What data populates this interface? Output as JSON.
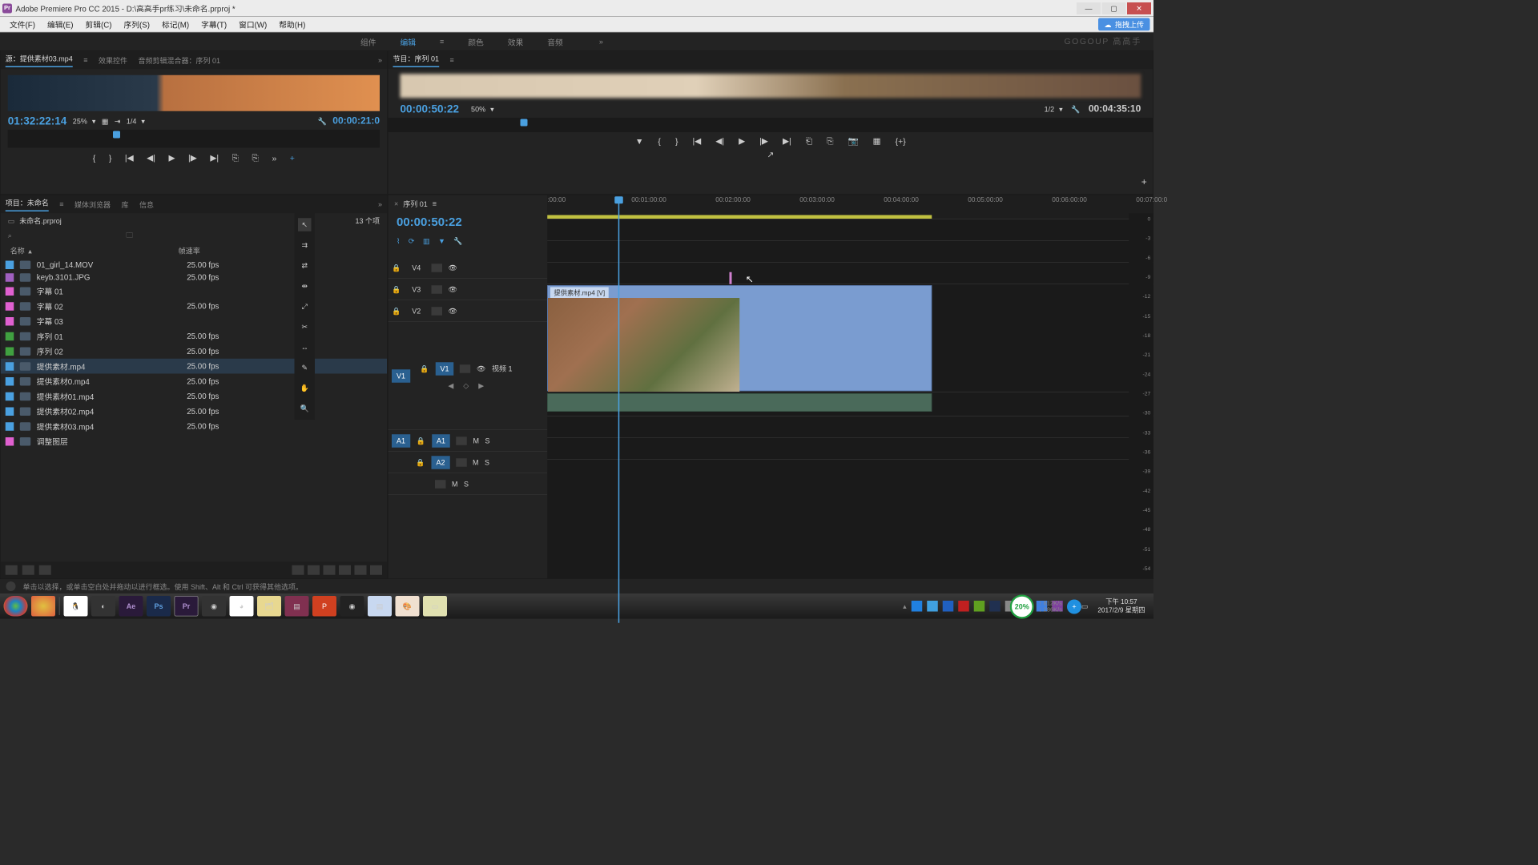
{
  "titlebar": {
    "logo_text": "Pr",
    "title": "Adobe Premiere Pro CC 2015 - D:\\高高手pr练习\\未命名.prproj *"
  },
  "menu": {
    "items": [
      "文件(F)",
      "编辑(E)",
      "剪辑(C)",
      "序列(S)",
      "标记(M)",
      "字幕(T)",
      "窗口(W)",
      "帮助(H)"
    ],
    "upload": "拖拽上传"
  },
  "workspace": {
    "tabs": [
      "组件",
      "编辑",
      "颜色",
      "效果",
      "音频"
    ],
    "brand": "GOGOUP 高高手"
  },
  "source": {
    "tab_source": "源：提供素材03.mp4",
    "tab_fx": "效果控件",
    "tab_mixer": "音频剪辑混合器：序列 01",
    "tc_left": "01:32:22:14",
    "zoom": "25%",
    "fit": "1/4",
    "tc_right": "00:00:21:0"
  },
  "program": {
    "tab": "节目：序列 01",
    "tc_left": "00:00:50:22",
    "zoom": "50%",
    "fit": "1/2",
    "tc_right": "00:04:35:10"
  },
  "project": {
    "tab_project": "项目：未命名",
    "tab_media": "媒体浏览器",
    "tab_lib": "库",
    "tab_info": "信息",
    "file": "未命名.prproj",
    "count": "13 个项",
    "col_name": "名称",
    "col_fps": "帧速率",
    "items": [
      {
        "swatch": "#4aa0e0",
        "name": "01_girl_14.MOV",
        "fps": "25.00 fps"
      },
      {
        "swatch": "#a060c0",
        "name": "keyb.3101.JPG",
        "fps": "25.00 fps"
      },
      {
        "swatch": "#e060d0",
        "name": "字幕 01",
        "fps": ""
      },
      {
        "swatch": "#e060d0",
        "name": "字幕 02",
        "fps": "25.00 fps"
      },
      {
        "swatch": "#e060d0",
        "name": "字幕 03",
        "fps": ""
      },
      {
        "swatch": "#40a040",
        "name": "序列 01",
        "fps": "25.00 fps"
      },
      {
        "swatch": "#40a040",
        "name": "序列 02",
        "fps": "25.00 fps"
      },
      {
        "swatch": "#4aa0e0",
        "name": "提供素材.mp4",
        "fps": "25.00 fps",
        "sel": true
      },
      {
        "swatch": "#4aa0e0",
        "name": "提供素材0.mp4",
        "fps": "25.00 fps"
      },
      {
        "swatch": "#4aa0e0",
        "name": "提供素材01.mp4",
        "fps": "25.00 fps"
      },
      {
        "swatch": "#4aa0e0",
        "name": "提供素材02.mp4",
        "fps": "25.00 fps"
      },
      {
        "swatch": "#4aa0e0",
        "name": "提供素材03.mp4",
        "fps": "25.00 fps"
      },
      {
        "swatch": "#e060d0",
        "name": "调整图层",
        "fps": ""
      }
    ]
  },
  "timeline": {
    "seq": "序列 01",
    "tc": "00:00:50:22",
    "ticks": [
      ":00:00",
      "00:01:00:00",
      "00:02:00:00",
      "00:03:00:00",
      "00:04:00:00",
      "00:05:00:00",
      "00:06:00:00",
      "00:07:00:0"
    ],
    "tracks": {
      "v4": "V4",
      "v3": "V3",
      "v2": "V2",
      "v1": "V1",
      "v1_label": "视频 1",
      "a1": "A1",
      "a2": "A2"
    },
    "ms_m": "M",
    "ms_s": "S",
    "clip_label": "提供素材.mp4 [V]"
  },
  "meter_vals": [
    "0",
    "-3",
    "-6",
    "-9",
    "-12",
    "-15",
    "-18",
    "-21",
    "-24",
    "-27",
    "-30",
    "-33",
    "-36",
    "-39",
    "-42",
    "-45",
    "-48",
    "-51",
    "-54"
  ],
  "status": {
    "text": "单击以选择，或单击空白处并拖动以进行框选。使用 Shift、Alt 和 Ctrl 可获得其他选项。"
  },
  "net": {
    "pct": "20%",
    "up": "812K/s",
    "down": "286K/s"
  },
  "clock": {
    "time": "下午 10:57",
    "date": "2017/2/9 星期四"
  }
}
